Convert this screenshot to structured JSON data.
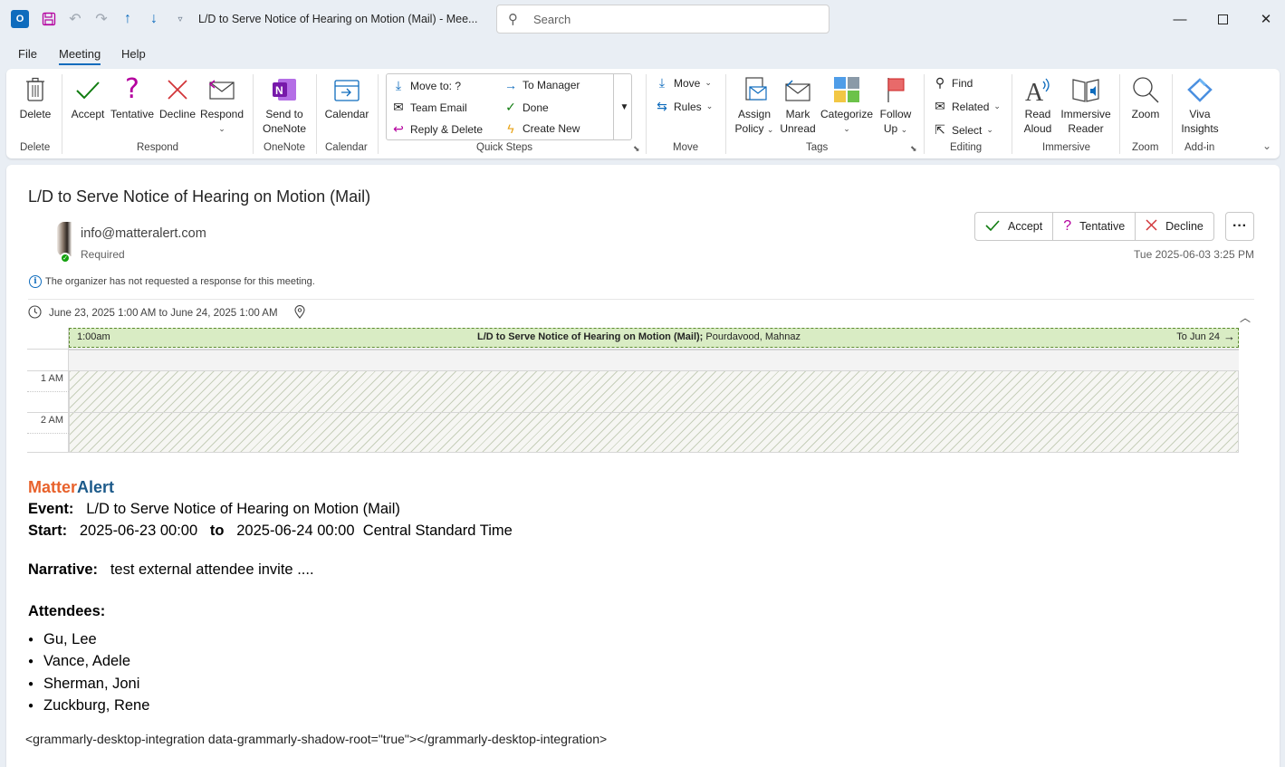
{
  "window": {
    "title": "L/D to Serve Notice of Hearing on Motion (Mail)  -  Mee...",
    "search_placeholder": "Search",
    "app_logo": "O"
  },
  "menu": {
    "tabs": [
      "File",
      "Meeting",
      "Help"
    ],
    "active": "Meeting"
  },
  "ribbon": {
    "delete": {
      "label": "Delete",
      "group": "Delete"
    },
    "respond": {
      "accept": "Accept",
      "tentative": "Tentative",
      "decline": "Decline",
      "respond": "Respond",
      "group": "Respond"
    },
    "onenote": {
      "label1": "Send to",
      "label2": "OneNote",
      "group": "OneNote"
    },
    "calendar": {
      "label": "Calendar",
      "group": "Calendar"
    },
    "quicksteps": {
      "items": [
        "Move to: ?",
        "Team Email",
        "Reply & Delete",
        "To Manager",
        "Done",
        "Create New"
      ],
      "group": "Quick Steps"
    },
    "move": {
      "move": "Move",
      "rules": "Rules",
      "group": "Move"
    },
    "tags": {
      "assign1": "Assign",
      "assign2": "Policy",
      "mark1": "Mark",
      "mark2": "Unread",
      "categorize": "Categorize",
      "follow1": "Follow",
      "follow2": "Up",
      "group": "Tags"
    },
    "editing": {
      "find": "Find",
      "related": "Related",
      "select": "Select",
      "group": "Editing"
    },
    "immersive": {
      "read1": "Read",
      "read2": "Aloud",
      "imm1": "Immersive",
      "imm2": "Reader",
      "group": "Immersive"
    },
    "zoom": {
      "label": "Zoom",
      "group": "Zoom"
    },
    "addin": {
      "label1": "Viva",
      "label2": "Insights",
      "group": "Add-in"
    }
  },
  "message": {
    "subject": "L/D to Serve Notice of Hearing on Motion (Mail)",
    "sender": "info@matteralert.com",
    "attendance": "Required",
    "response_buttons": {
      "accept": "Accept",
      "tentative": "Tentative",
      "decline": "Decline"
    },
    "sent": "Tue 2025-06-03 3:25 PM",
    "info": "The organizer has not requested a response for this meeting.",
    "when": "June 23, 2025 1:00 AM to June 24, 2025 1:00 AM"
  },
  "calendar_preview": {
    "event_start": "1:00am",
    "event_title": "L/D to Serve Notice of Hearing on Motion (Mail);",
    "event_organizer": " Pourdavood, Mahnaz",
    "event_end": "To Jun 24",
    "hours": [
      "1 AM",
      "2 AM"
    ]
  },
  "body": {
    "brand_part1": "Matter",
    "brand_part2": "Alert",
    "event_label": "Event:",
    "event_value": "L/D to Serve Notice of Hearing on Motion (Mail)",
    "start_label": "Start:",
    "start_value": "2025-06-23 00:00",
    "to_label": "to",
    "end_value": "2025-06-24 00:00",
    "timezone": "Central Standard Time",
    "narrative_label": "Narrative:",
    "narrative_value": "test external attendee invite ....",
    "attendees_label": "Attendees:",
    "attendees": [
      "Gu, Lee",
      "Vance, Adele",
      "Sherman, Joni",
      "Zuckburg, Rene"
    ],
    "raw_tag": "<grammarly-desktop-integration data-grammarly-shadow-root=\"true\"></grammarly-desktop-integration>"
  },
  "colors": {
    "accent": "#0f6cbd",
    "brand_orange": "#e8622c",
    "brand_blue": "#1c5a8a",
    "event_green": "#d9ecc4",
    "accept_green": "#107c10",
    "decline_red": "#d13438"
  }
}
